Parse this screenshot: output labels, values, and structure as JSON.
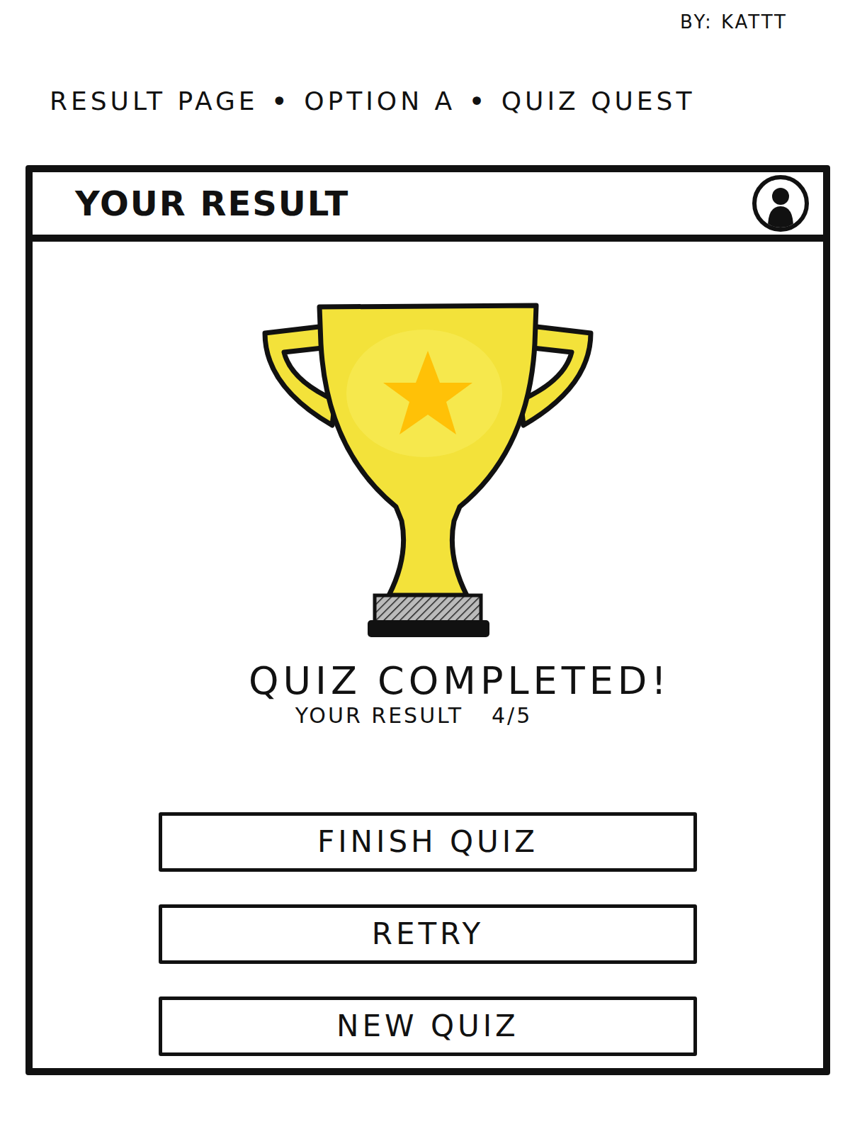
{
  "author": "BY: KATTT",
  "heading": {
    "parts": [
      "RESULT PAGE",
      "OPTION A",
      "QUIZ QUEST"
    ],
    "separator": "•"
  },
  "window": {
    "title": "YOUR RESULT"
  },
  "result": {
    "message": "QUIZ COMPLETED!",
    "label": "YOUR RESULT",
    "score": "4/5"
  },
  "buttons": [
    "FINISH QUIZ",
    "RETRY",
    "NEW QUIZ"
  ]
}
